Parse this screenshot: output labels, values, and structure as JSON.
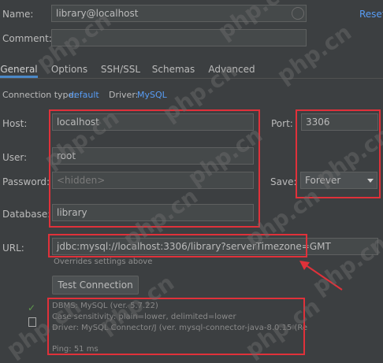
{
  "name": {
    "label": "Name:",
    "value": "library@localhost",
    "reset": "Reset"
  },
  "comment": {
    "label": "Comment:",
    "value": ""
  },
  "tabs": [
    {
      "label": "General"
    },
    {
      "label": "Options"
    },
    {
      "label": "SSH/SSL"
    },
    {
      "label": "Schemas"
    },
    {
      "label": "Advanced"
    }
  ],
  "connection": {
    "type_label": "Connection type:",
    "type_value": "default",
    "driver_label": "Driver:",
    "driver_value": "MySQL"
  },
  "host": {
    "label": "Host:",
    "value": "localhost"
  },
  "port": {
    "label": "Port:",
    "value": "3306"
  },
  "user": {
    "label": "User:",
    "value": "root"
  },
  "password": {
    "label": "Password:",
    "value": "<hidden>"
  },
  "save": {
    "label": "Save:",
    "value": "Forever"
  },
  "database": {
    "label": "Database:",
    "value": "library"
  },
  "url": {
    "label": "URL:",
    "value": "jdbc:mysql://localhost:3306/library?serverTimezone=GMT",
    "note": "Overrides settings above"
  },
  "test_button": {
    "label": "Test Connection"
  },
  "info": {
    "dbms": "DBMS: MySQL (ver. 5.7.22)",
    "case": "Case sensitivity: plain=lower, delimited=lower",
    "driver": "Driver: MySQL Connector/J (ver. mysql-connector-java-8.0.15 (Re",
    "ping": "Ping: 51 ms"
  },
  "watermark": "php.cn"
}
